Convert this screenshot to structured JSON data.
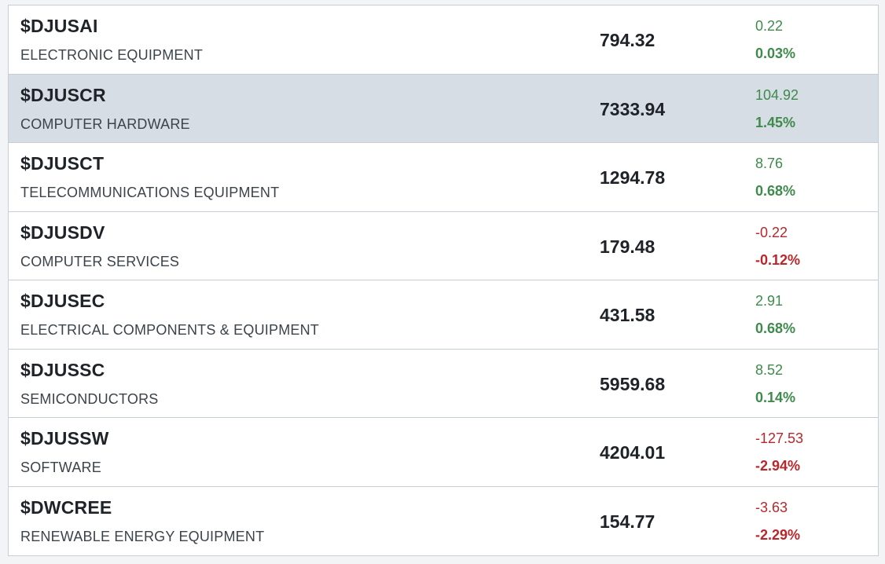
{
  "colors": {
    "up": "#3f8a4c",
    "down": "#b8272c",
    "selected_row": "#d6dde4"
  },
  "rows": [
    {
      "symbol": "$DJUSAI",
      "name": "ELECTRONIC EQUIPMENT",
      "price": "794.32",
      "change": "0.22",
      "pct": "0.03%",
      "direction": "up",
      "selected": false
    },
    {
      "symbol": "$DJUSCR",
      "name": "COMPUTER HARDWARE",
      "price": "7333.94",
      "change": "104.92",
      "pct": "1.45%",
      "direction": "up",
      "selected": true
    },
    {
      "symbol": "$DJUSCT",
      "name": "TELECOMMUNICATIONS EQUIPMENT",
      "price": "1294.78",
      "change": "8.76",
      "pct": "0.68%",
      "direction": "up",
      "selected": false
    },
    {
      "symbol": "$DJUSDV",
      "name": "COMPUTER SERVICES",
      "price": "179.48",
      "change": "-0.22",
      "pct": "-0.12%",
      "direction": "down",
      "selected": false
    },
    {
      "symbol": "$DJUSEC",
      "name": "ELECTRICAL COMPONENTS & EQUIPMENT",
      "price": "431.58",
      "change": "2.91",
      "pct": "0.68%",
      "direction": "up",
      "selected": false
    },
    {
      "symbol": "$DJUSSC",
      "name": "SEMICONDUCTORS",
      "price": "5959.68",
      "change": "8.52",
      "pct": "0.14%",
      "direction": "up",
      "selected": false
    },
    {
      "symbol": "$DJUSSW",
      "name": "SOFTWARE",
      "price": "4204.01",
      "change": "-127.53",
      "pct": "-2.94%",
      "direction": "down",
      "selected": false
    },
    {
      "symbol": "$DWCREE",
      "name": "RENEWABLE ENERGY EQUIPMENT",
      "price": "154.77",
      "change": "-3.63",
      "pct": "-2.29%",
      "direction": "down",
      "selected": false
    }
  ]
}
